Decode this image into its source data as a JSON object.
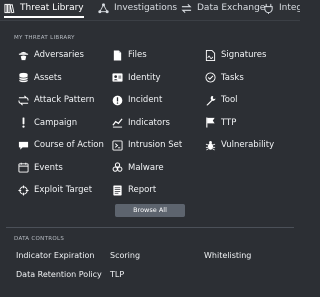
{
  "topnav": {
    "tabs": [
      {
        "label": "Threat Library",
        "icon": "library-icon",
        "active": true
      },
      {
        "label": "Investigations",
        "icon": "network-icon",
        "active": false
      },
      {
        "label": "Data Exchange",
        "icon": "exchange-icon",
        "active": false
      },
      {
        "label": "Integ",
        "icon": "plug-icon",
        "active": false
      }
    ]
  },
  "threat_library": {
    "section_label": "MY THREAT LIBRARY",
    "col1": [
      {
        "label": "Adversaries",
        "icon": "adversary-icon"
      },
      {
        "label": "Assets",
        "icon": "database-icon"
      },
      {
        "label": "Attack Pattern",
        "icon": "pattern-icon"
      },
      {
        "label": "Campaign",
        "icon": "exclamation-icon"
      },
      {
        "label": "Course of Action",
        "icon": "chat-icon"
      },
      {
        "label": "Events",
        "icon": "events-icon"
      },
      {
        "label": "Exploit Target",
        "icon": "crosshair-icon"
      }
    ],
    "col2": [
      {
        "label": "Files",
        "icon": "file-icon"
      },
      {
        "label": "Identity",
        "icon": "id-card-icon"
      },
      {
        "label": "Incident",
        "icon": "alert-circle-icon"
      },
      {
        "label": "Indicators",
        "icon": "indicator-icon"
      },
      {
        "label": "Intrusion Set",
        "icon": "intrusion-icon"
      },
      {
        "label": "Malware",
        "icon": "biohazard-icon"
      },
      {
        "label": "Report",
        "icon": "report-icon"
      }
    ],
    "col3": [
      {
        "label": "Signatures",
        "icon": "signature-icon"
      },
      {
        "label": "Tasks",
        "icon": "check-circle-icon"
      },
      {
        "label": "Tool",
        "icon": "wrench-icon"
      },
      {
        "label": "TTP",
        "icon": "flag-icon"
      },
      {
        "label": "Vulnerability",
        "icon": "bug-icon"
      }
    ],
    "browse_all": "Browse All"
  },
  "data_controls": {
    "section_label": "DATA CONTROLS",
    "items": [
      "Indicator Expiration",
      "Scoring",
      "Whitelisting",
      "Data Retention Policy",
      "TLP"
    ]
  },
  "colors": {
    "background": "#2c2f34",
    "button": "#5d646e",
    "text": "#f4f6f8"
  }
}
